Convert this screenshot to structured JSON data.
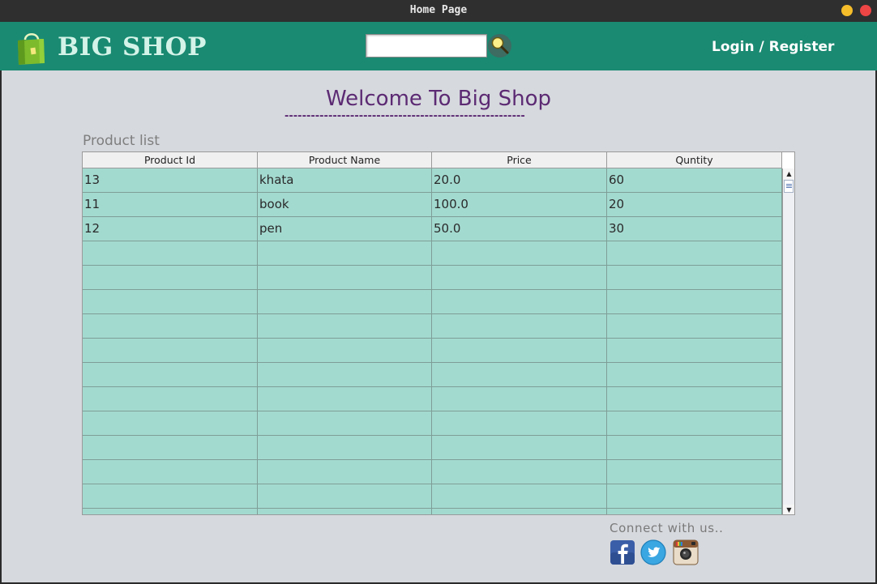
{
  "window": {
    "title": "Home Page"
  },
  "header": {
    "brand": "BIG SHOP",
    "search": {
      "value": "",
      "placeholder": ""
    },
    "login_label": "Login / Register"
  },
  "main": {
    "welcome": "Welcome To Big Shop",
    "welcome_underline": "-------------------------------------------------------",
    "section_title": "Product list",
    "table": {
      "columns": [
        "Product Id",
        "Product Name",
        "Price",
        "Quntity"
      ],
      "rows": [
        [
          "13",
          "khata",
          "20.0",
          "60"
        ],
        [
          "11",
          "book",
          "100.0",
          "20"
        ],
        [
          "12",
          "pen",
          "50.0",
          "30"
        ],
        [
          "",
          "",
          "",
          ""
        ],
        [
          "",
          "",
          "",
          ""
        ],
        [
          "",
          "",
          "",
          ""
        ],
        [
          "",
          "",
          "",
          ""
        ],
        [
          "",
          "",
          "",
          ""
        ],
        [
          "",
          "",
          "",
          ""
        ],
        [
          "",
          "",
          "",
          ""
        ],
        [
          "",
          "",
          "",
          ""
        ],
        [
          "",
          "",
          "",
          ""
        ],
        [
          "",
          "",
          "",
          ""
        ],
        [
          "",
          "",
          "",
          ""
        ],
        [
          "",
          "",
          "",
          ""
        ]
      ]
    }
  },
  "footer": {
    "connect_text": "Connect with us..",
    "social_icons": [
      "facebook-icon",
      "twitter-icon",
      "instagram-icon"
    ]
  },
  "colors": {
    "header_bg": "#1a8a72",
    "brand_text": "#d4f3e8",
    "welcome_text": "#5c2a73",
    "table_row_bg": "#a3dad0",
    "page_bg": "#d6d9de"
  }
}
